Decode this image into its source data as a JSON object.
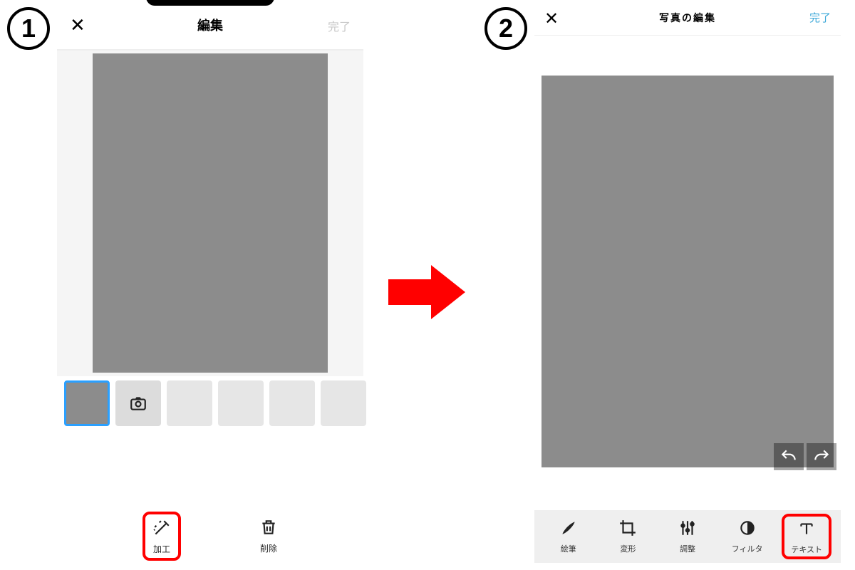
{
  "steps": {
    "one": "1",
    "two": "2"
  },
  "panel1": {
    "header": {
      "title": "編集",
      "done": "完了"
    },
    "bottom": {
      "process": "加工",
      "delete": "削除"
    }
  },
  "panel2": {
    "header": {
      "title": "写真の編集",
      "done": "完了"
    },
    "tools": {
      "brush": "絵筆",
      "transform": "変形",
      "adjust": "調整",
      "filter": "フィルタ",
      "text": "テキスト"
    }
  }
}
